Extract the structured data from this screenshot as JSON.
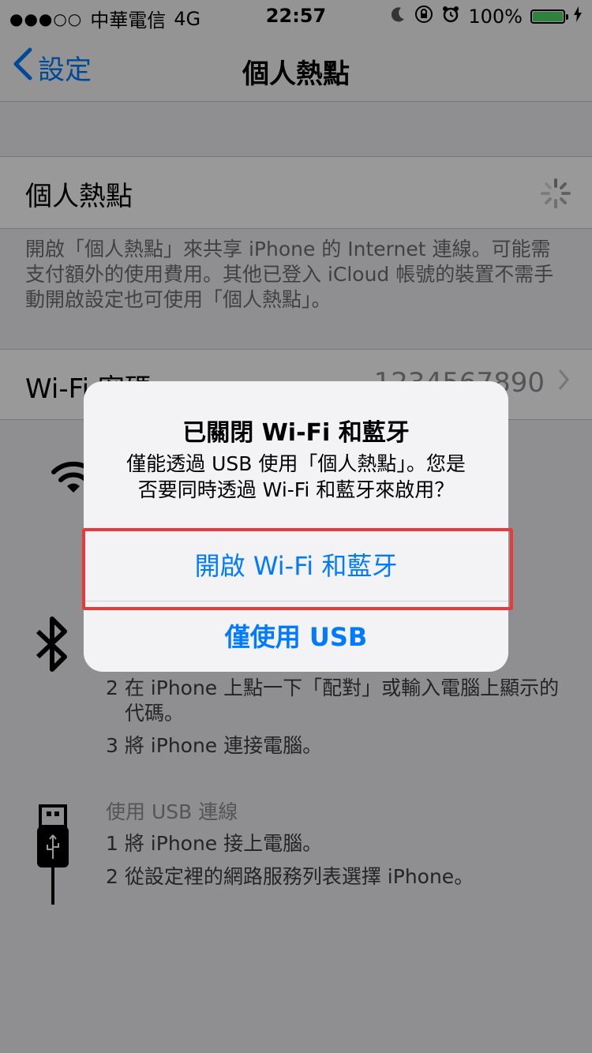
{
  "status": {
    "signal": "●●●○○",
    "carrier": "中華電信",
    "network": "4G",
    "time": "22:57",
    "battery": "100%",
    "battery_level": 1.0
  },
  "nav": {
    "back_label": "設定",
    "title": "個人熱點"
  },
  "hotspot_row": {
    "label": "個人熱點"
  },
  "hotspot_footer": "開啟「個人熱點」來共享 iPhone 的 Internet 連線。可能需支付額外的使用費用。其他已登入 iCloud 帳號的裝置不需手動開啟設定也可使用「個人熱點」。",
  "wifi_row": {
    "label": "Wi-Fi 密碼",
    "value": "1234567890"
  },
  "bluetooth_instructions": {
    "step2": "2 在 iPhone 上點一下「配對」或輸入電腦上顯示的",
    "step2b": "代碼。",
    "step3": "3 將 iPhone 連接電腦。"
  },
  "usb_instructions": {
    "header": "使用 USB 連線",
    "step1": "1 將 iPhone 接上電腦。",
    "step2": "2 從設定裡的網路服務列表選擇 iPhone。"
  },
  "alert": {
    "title": "已關閉 Wi-Fi 和藍牙",
    "message_line1": "僅能透過 USB 使用「個人熱點」。您是",
    "message_line2": "否要同時透過 Wi-Fi 和藍牙來啟用？",
    "button_enable": "開啟 Wi-Fi 和藍牙",
    "button_usb": "僅使用 USB"
  },
  "colors": {
    "accent": "#007aff",
    "highlight": "#e53b3b",
    "battery": "#4cd964"
  },
  "icons": [
    "chevron-left-icon",
    "wifi-icon",
    "bluetooth-icon",
    "usb-icon",
    "moon-icon",
    "rotation-lock-icon",
    "alarm-icon",
    "battery-icon",
    "charging-icon",
    "spinner-icon",
    "chevron-right-icon"
  ]
}
